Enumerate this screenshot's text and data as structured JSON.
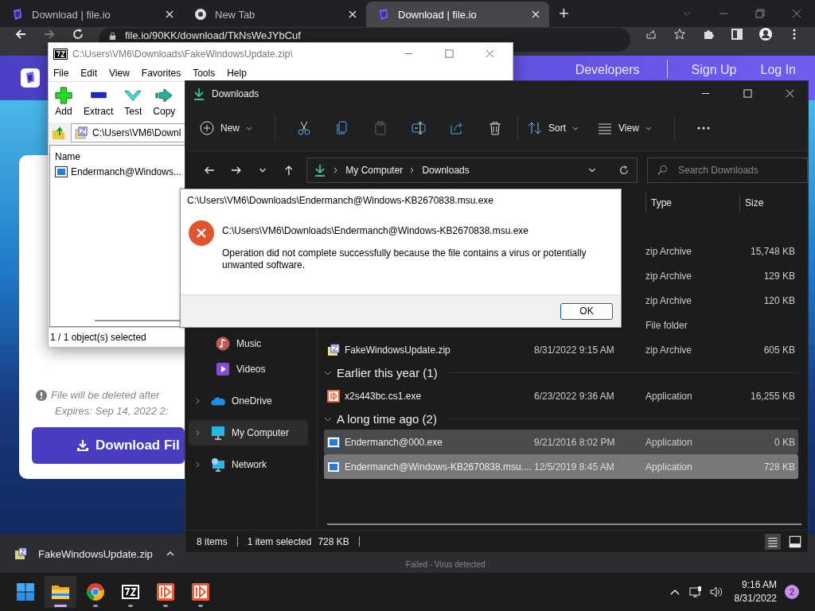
{
  "browser": {
    "tabs": [
      {
        "title": "Download | file.io",
        "kind": "fileio",
        "selected": false
      },
      {
        "title": "New Tab",
        "kind": "chrome",
        "selected": false
      },
      {
        "title": "Download | file.io",
        "kind": "fileio",
        "selected": true
      }
    ],
    "new_tab": "+",
    "url": "file.io/90KK/download/TkNsWeJYbCuf",
    "nav_links": [
      "Developers",
      "Sign Up",
      "Log In"
    ],
    "notice": "File will be deleted after",
    "expires": "Expires: Sep 14, 2022 2:",
    "download_button": "Download Fil",
    "download_bar": {
      "file": "FakeWindowsUpdate.zip",
      "failed_status": "Failed - Virus detected"
    }
  },
  "sevenzip": {
    "title": "C:\\Users\\VM6\\Downloads\\FakeWindowsUpdate.zip\\",
    "menu": [
      "File",
      "Edit",
      "View",
      "Favorites",
      "Tools",
      "Help"
    ],
    "toolbar": [
      {
        "label": "Add",
        "kind": "add"
      },
      {
        "label": "Extract",
        "kind": "extract"
      },
      {
        "label": "Test",
        "kind": "test"
      },
      {
        "label": "Copy",
        "kind": "copy"
      }
    ],
    "path": "C:\\Users\\VM6\\Downl",
    "column": "Name",
    "rows": [
      "Endermanch@Windows..."
    ],
    "status": "1 / 1 object(s) selected"
  },
  "explorer": {
    "title": "Downloads",
    "toolbar": [
      {
        "kind": "new",
        "label": "New",
        "disabled": false
      },
      {
        "kind": "cut",
        "disabled": false
      },
      {
        "kind": "copy",
        "disabled": false
      },
      {
        "kind": "paste",
        "disabled": true
      },
      {
        "kind": "rename",
        "disabled": false
      },
      {
        "kind": "share",
        "disabled": false
      },
      {
        "kind": "delete",
        "disabled": false
      },
      {
        "kind": "sort",
        "label": "Sort",
        "disabled": false
      },
      {
        "kind": "view",
        "label": "View",
        "disabled": false
      },
      {
        "kind": "more",
        "disabled": false
      }
    ],
    "breadcrumb": [
      "My Computer",
      "Downloads"
    ],
    "search": {
      "placeholder": "Search Downloads"
    },
    "sidebar": [
      {
        "label": "Music",
        "kind": "music",
        "expandable": false,
        "selected": false
      },
      {
        "label": "Videos",
        "kind": "videos",
        "expandable": false,
        "selected": false
      },
      {
        "label": "OneDrive",
        "kind": "onedrive",
        "expandable": true,
        "selected": false
      },
      {
        "label": "My Computer",
        "kind": "computer",
        "expandable": true,
        "selected": true
      },
      {
        "label": "Network",
        "kind": "network",
        "expandable": true,
        "selected": false
      }
    ],
    "columns": [
      "Type",
      "Size"
    ],
    "items": [
      {
        "kind": "file",
        "type": "zip Archive",
        "size": "15,748 KB",
        "selected": false,
        "hovered": false
      },
      {
        "kind": "file",
        "type": "zip Archive",
        "size": "129 KB",
        "selected": false,
        "hovered": false
      },
      {
        "kind": "file",
        "type": "zip Archive",
        "size": "120 KB",
        "selected": false,
        "hovered": false
      },
      {
        "kind": "file",
        "type": "File folder",
        "selected": false,
        "hovered": false
      },
      {
        "kind": "zip",
        "name": "FakeWindowsUpdate.zip",
        "date": "8/31/2022 9:15 AM",
        "type": "zip Archive",
        "size": "605 KB",
        "selected": false,
        "hovered": false
      },
      {
        "kind": "group",
        "label": "Earlier this year (1)"
      },
      {
        "kind": "red-app",
        "name": "x2s443bc.cs1.exe",
        "date": "6/23/2022 9:36 AM",
        "type": "Application",
        "size": "16,255 KB",
        "selected": false,
        "hovered": false
      },
      {
        "kind": "group",
        "label": "A long time ago (2)"
      },
      {
        "kind": "app",
        "name": "Endermanch@000.exe",
        "date": "9/21/2016 8:02 PM",
        "type": "Application",
        "size": "0 KB",
        "selected": false,
        "hovered": true
      },
      {
        "kind": "app",
        "name": "Endermanch@Windows-KB2670838.msu....",
        "date": "12/5/2019 8:45 AM",
        "type": "Application",
        "size": "728 KB",
        "selected": true,
        "hovered": false
      }
    ],
    "status": {
      "count": "8 items",
      "selection": "1 item selected",
      "size": "728 KB"
    }
  },
  "dialog": {
    "title": "C:\\Users\\VM6\\Downloads\\Endermanch@Windows-KB2670838.msu.exe",
    "path": "C:\\Users\\VM6\\Downloads\\Endermanch@Windows-KB2670838.msu.exe",
    "message": "Operation did not complete successfully because the file contains a virus or potentially unwanted software.",
    "button": "OK"
  },
  "taskbar": {
    "apps": [
      {
        "kind": "start",
        "selected": false
      },
      {
        "kind": "explorer",
        "selected": true
      },
      {
        "kind": "chrome",
        "selected": false
      },
      {
        "kind": "sevenzip",
        "selected": false
      },
      {
        "kind": "red-app",
        "selected": false
      },
      {
        "kind": "red-app",
        "selected": false
      }
    ],
    "time": "9:16 AM",
    "date": "8/31/2022",
    "notifications": "2"
  }
}
